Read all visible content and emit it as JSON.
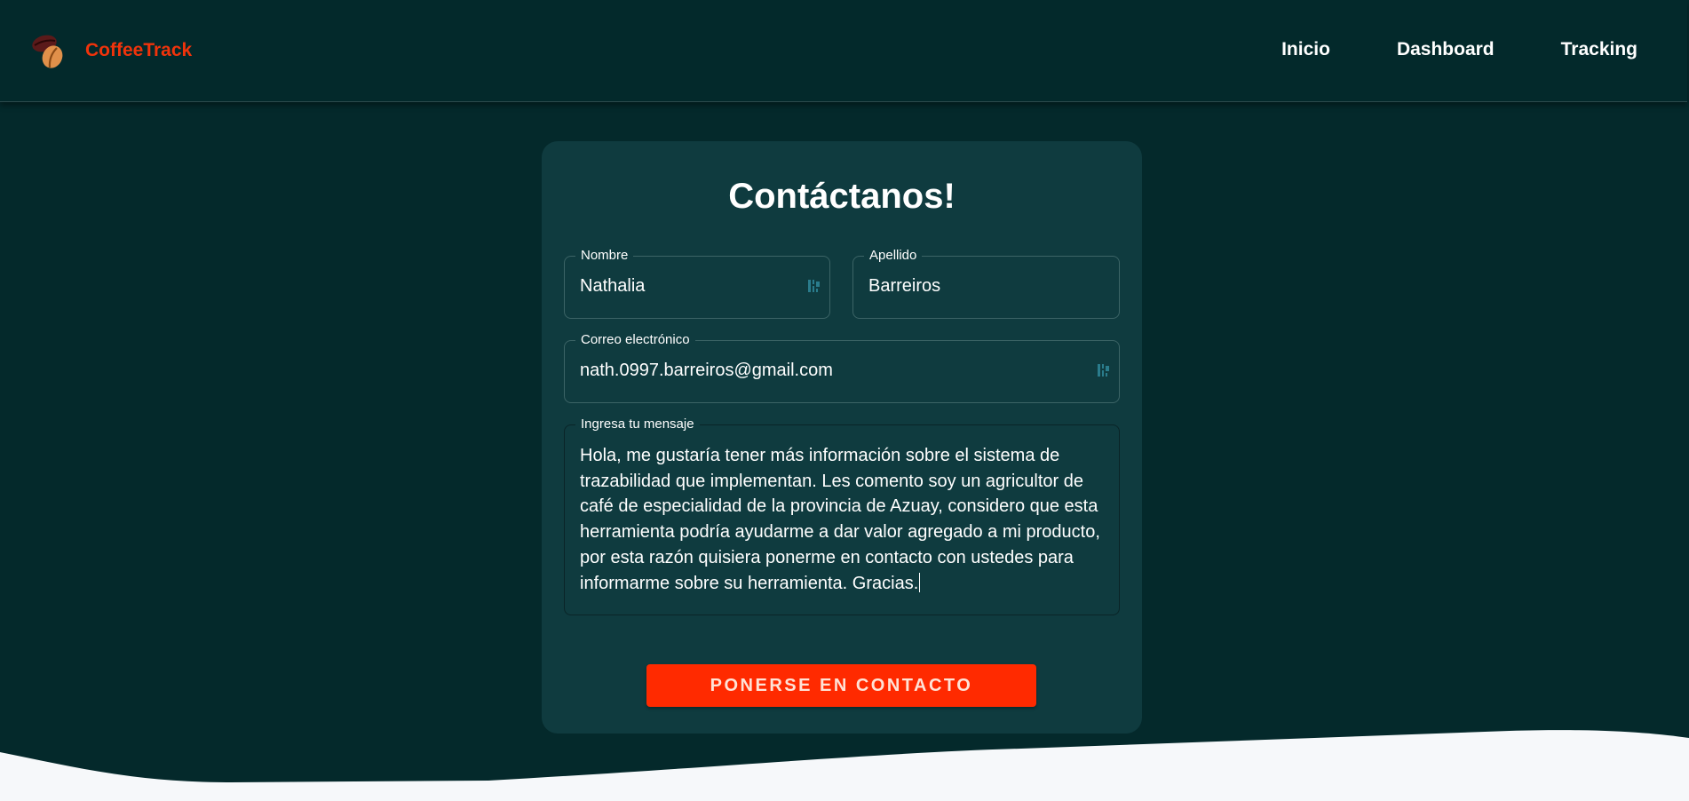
{
  "header": {
    "brand_name": "CoffeeTrack",
    "logo_icon": "coffee-beans-icon",
    "nav": [
      {
        "label": "Inicio"
      },
      {
        "label": "Dashboard"
      },
      {
        "label": "Tracking"
      }
    ]
  },
  "form": {
    "title": "Contáctanos!",
    "first_name": {
      "label": "Nombre",
      "value": "Nathalia"
    },
    "last_name": {
      "label": "Apellido",
      "value": "Barreiros"
    },
    "email": {
      "label": "Correo electrónico",
      "value": "nath.0997.barreiros@gmail.com"
    },
    "message": {
      "label": "Ingresa tu mensaje",
      "value": "Hola, me gustaría tener más información sobre el sistema de trazabilidad que implementan. Les comento soy un agricultor de café de especialidad de la provincia de Azuay, considero que esta herramienta podría ayudarme a dar valor agregado a mi producto, por esta razón quisiera ponerme en contacto con ustedes para informarme sobre su herramienta. Gracias."
    },
    "submit_label": "PONERSE EN CONTACTO",
    "autofill_icon": "password-manager-icon"
  },
  "colors": {
    "background": "#04292b",
    "card": "#0f3b3f",
    "accent": "#ff2a00",
    "brand": "#f0330b",
    "footer_wave": "#f6f8fa"
  }
}
